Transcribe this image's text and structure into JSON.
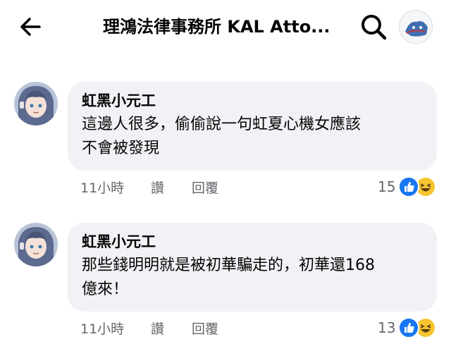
{
  "header": {
    "title": "理鴻法律事務所 KAL Atto..."
  },
  "comments": [
    {
      "author": "虹黑小元工",
      "text_line1": "這邊人很多，偷偷說一句虹夏心機女應該",
      "text_line2": "不會被發現",
      "time": "11小時",
      "like_label": "讚",
      "reply_label": "回覆",
      "reaction_count": "15",
      "reactions": [
        "like-icon",
        "haha-icon"
      ]
    },
    {
      "author": "虹黑小元工",
      "text_line1": "那些錢明明就是被初華騙走的，初華還168",
      "text_line2": "億來！",
      "time": "11小時",
      "like_label": "讚",
      "reply_label": "回覆",
      "reaction_count": "13",
      "reactions": [
        "like-icon",
        "haha-icon"
      ]
    }
  ],
  "colors": {
    "bubble": "#f0f2f5",
    "meta_text": "#65676b",
    "like_blue": "#1877f2",
    "haha_yellow": "#f7c531"
  }
}
